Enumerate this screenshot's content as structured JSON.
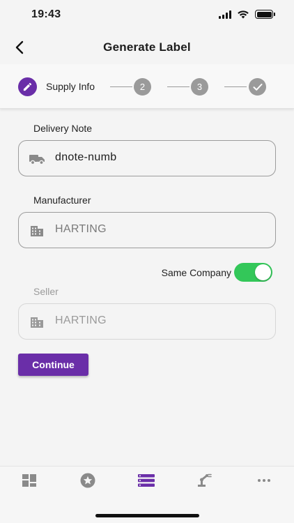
{
  "status_bar": {
    "time": "19:43",
    "icons": [
      "signal-icon",
      "wifi-icon",
      "battery-icon"
    ]
  },
  "header": {
    "title": "Generate Label",
    "back_icon": "chevron-left-icon"
  },
  "stepper": {
    "active_step_label": "Supply Info",
    "active_step_icon": "pencil-icon",
    "steps": [
      "2",
      "3"
    ],
    "final_step_icon": "check-icon",
    "colors": {
      "active": "#6a2ea8",
      "inactive": "#9a9a9a"
    }
  },
  "form": {
    "delivery_note": {
      "label": "Delivery Note",
      "value": "dnote-numb",
      "icon": "truck-icon"
    },
    "manufacturer": {
      "label": "Manufacturer",
      "value": "HARTING",
      "icon": "building-icon"
    },
    "same_company": {
      "label": "Same Company",
      "enabled": true,
      "color": "#33c759"
    },
    "seller": {
      "label": "Seller",
      "value": "HARTING",
      "icon": "building-icon",
      "disabled": true
    },
    "continue_label": "Continue"
  },
  "tab_bar": {
    "items": [
      {
        "icon": "dashboard-icon",
        "active": false
      },
      {
        "icon": "star-icon",
        "active": false
      },
      {
        "icon": "list-icon",
        "active": true
      },
      {
        "icon": "robot-arm-icon",
        "active": false
      },
      {
        "icon": "more-icon",
        "active": false
      }
    ],
    "colors": {
      "active": "#6a2ea8",
      "inactive": "#8a8a8a"
    }
  }
}
